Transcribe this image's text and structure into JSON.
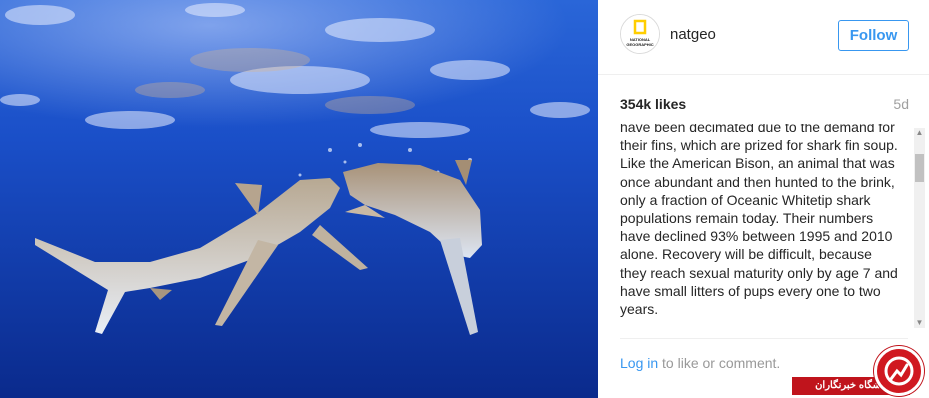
{
  "post": {
    "username": "natgeo",
    "follow_label": "Follow",
    "likes": "354k likes",
    "age": "5d",
    "caption": "have been decimated due to the demand for their fins, which are prized for shark fin soup. Like the American Bison, an animal that was once abundant and then hunted to the brink, only a fraction of Oceanic Whitetip shark populations remain today. Their numbers have declined 93% between 1995 and 2010 alone. Recovery will be difficult, because they reach sexual maturity only by age 7 and have small litters of pups every one to two years."
  },
  "comment": {
    "login_label": "Log in",
    "rest": " to like or comment."
  },
  "avatar": {
    "brand_line1": "NATIONAL",
    "brand_line2": "GEOGRAPHIC",
    "frame_color": "#ffce00"
  },
  "watermark": {
    "text": "باشگاه خبرنگاران"
  },
  "colors": {
    "accent": "#3897f0",
    "ocean_deep": "#0b2a8a",
    "ocean_mid": "#1a4fd0"
  }
}
